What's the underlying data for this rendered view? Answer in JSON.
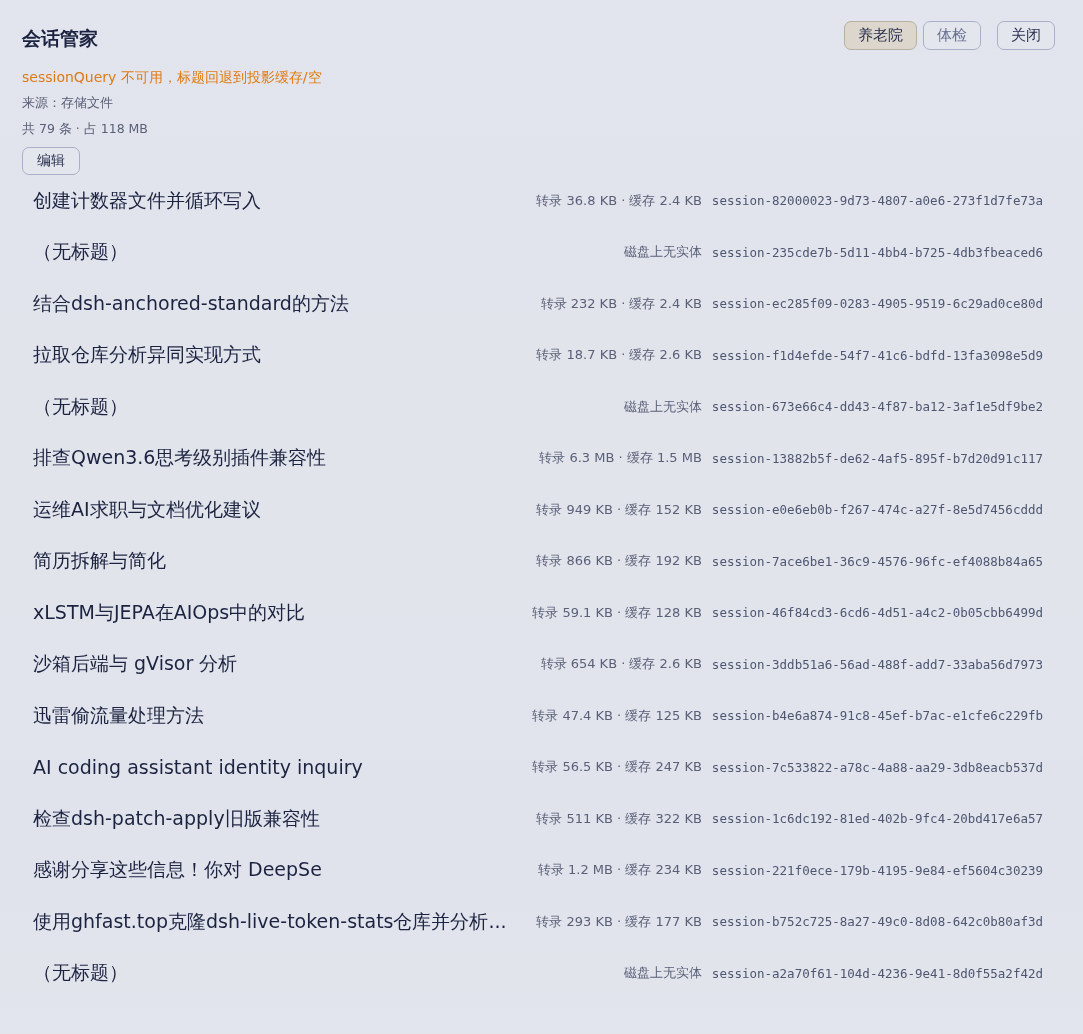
{
  "panel": {
    "title": "会话管家",
    "warning": "sessionQuery 不可用，标题回退到投影缓存/空",
    "source": "来源：存储文件",
    "summary": "共 79 条 · 占 118 MB",
    "edit_button": "编辑",
    "filters": [
      {
        "label": "养老院",
        "selected": true
      },
      {
        "label": "体检",
        "selected": false
      }
    ],
    "close_button": "关闭"
  },
  "sessions": [
    {
      "title": "创建计数器文件并循环写入",
      "meta": "转录 36.8 KB · 缓存 2.4 KB",
      "id": "session-82000023-9d73-4807-a0e6-273f1d7fe73a"
    },
    {
      "title": "（无标题）",
      "meta": "磁盘上无实体",
      "id": "session-235cde7b-5d11-4bb4-b725-4db3fbeaced6"
    },
    {
      "title": "结合dsh-anchored-standard的方法",
      "meta": "转录 232 KB · 缓存 2.4 KB",
      "id": "session-ec285f09-0283-4905-9519-6c29ad0ce80d"
    },
    {
      "title": "拉取仓库分析异同实现方式",
      "meta": "转录 18.7 KB · 缓存 2.6 KB",
      "id": "session-f1d4efde-54f7-41c6-bdfd-13fa3098e5d9"
    },
    {
      "title": "（无标题）",
      "meta": "磁盘上无实体",
      "id": "session-673e66c4-dd43-4f87-ba12-3af1e5df9be2"
    },
    {
      "title": "排查Qwen3.6思考级别插件兼容性",
      "meta": "转录 6.3 MB · 缓存 1.5 MB",
      "id": "session-13882b5f-de62-4af5-895f-b7d20d91c117"
    },
    {
      "title": "运维AI求职与文档优化建议",
      "meta": "转录 949 KB · 缓存 152 KB",
      "id": "session-e0e6eb0b-f267-474c-a27f-8e5d7456cddd"
    },
    {
      "title": "简历拆解与简化",
      "meta": "转录 866 KB · 缓存 192 KB",
      "id": "session-7ace6be1-36c9-4576-96fc-ef4088b84a65"
    },
    {
      "title": "xLSTM与JEPA在AIOps中的对比",
      "meta": "转录 59.1 KB · 缓存 128 KB",
      "id": "session-46f84cd3-6cd6-4d51-a4c2-0b05cbb6499d"
    },
    {
      "title": "沙箱后端与 gVisor 分析",
      "meta": "转录 654 KB · 缓存 2.6 KB",
      "id": "session-3ddb51a6-56ad-488f-add7-33aba56d7973"
    },
    {
      "title": "迅雷偷流量处理方法",
      "meta": "转录 47.4 KB · 缓存 125 KB",
      "id": "session-b4e6a874-91c8-45ef-b7ac-e1cfe6c229fb"
    },
    {
      "title": "AI coding assistant identity inquiry",
      "meta": "转录 56.5 KB · 缓存 247 KB",
      "id": "session-7c533822-a78c-4a88-aa29-3db8eacb537d"
    },
    {
      "title": "检查dsh-patch-apply旧版兼容性",
      "meta": "转录 511 KB · 缓存 322 KB",
      "id": "session-1c6dc192-81ed-402b-9fc4-20bd417e6a57"
    },
    {
      "title": "感谢分享这些信息！你对 DeepSe",
      "meta": "转录 1.2 MB · 缓存 234 KB",
      "id": "session-221f0ece-179b-4195-9e84-ef5604c30239"
    },
    {
      "title": "使用ghfast.top克隆dsh-live-token-stats仓库并分析...",
      "meta": "转录 293 KB · 缓存 177 KB",
      "id": "session-b752c725-8a27-49c0-8d08-642c0b80af3d"
    },
    {
      "title": "（无标题）",
      "meta": "磁盘上无实体",
      "id": "session-a2a70f61-104d-4236-9e41-8d0f55a2f42d"
    }
  ]
}
